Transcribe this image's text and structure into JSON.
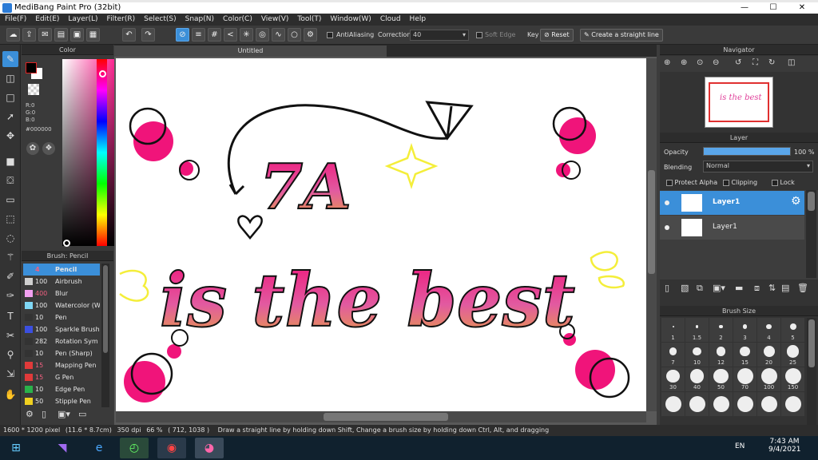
{
  "window": {
    "title": "MediBang Paint Pro (32bit)",
    "minimize": "—",
    "maximize": "☐",
    "close": "✕"
  },
  "menu": [
    "File(F)",
    "Edit(E)",
    "Layer(L)",
    "Filter(R)",
    "Select(S)",
    "Snap(N)",
    "Color(C)",
    "View(V)",
    "Tool(T)",
    "Window(W)",
    "Cloud",
    "Help"
  ],
  "toolbar": {
    "antialiasing_label": "AntiAliasing",
    "correction_label": "Correction",
    "correction_value": "40",
    "soft_edge_label": "Soft Edge",
    "key_label": "Key",
    "reset_label": "Reset",
    "straight_line_label": "Create a straight line"
  },
  "color_panel": {
    "title": "Color",
    "r": "R:0",
    "g": "G:0",
    "b": "B:0",
    "hex": "#000000",
    "foreground": "#000000",
    "background": "#ffffff"
  },
  "brush_panel": {
    "title": "Brush: Pencil",
    "items": [
      {
        "size": "4",
        "name": "Pencil",
        "color": "#3b8fd9"
      },
      {
        "size": "100",
        "name": "Airbrush",
        "color": "#cfcfcf"
      },
      {
        "size": "400",
        "name": "Blur",
        "color": "#f2a0f0"
      },
      {
        "size": "100",
        "name": "Watercolor (W",
        "color": "#7fd7f5"
      },
      {
        "size": "10",
        "name": "Pen",
        "color": "#333333"
      },
      {
        "size": "100",
        "name": "Sparkle Brush",
        "color": "#3b4fe0"
      },
      {
        "size": "282",
        "name": "Rotation Sym",
        "color": "#333333"
      },
      {
        "size": "10",
        "name": "Pen (Sharp)",
        "color": "#333333"
      },
      {
        "size": "15",
        "name": "Mapping Pen",
        "color": "#e03a3a"
      },
      {
        "size": "15",
        "name": "G Pen",
        "color": "#e03a3a"
      },
      {
        "size": "10",
        "name": "Edge Pen",
        "color": "#2ab24a"
      },
      {
        "size": "50",
        "name": "Stipple Pen",
        "color": "#f0d020"
      }
    ]
  },
  "document": {
    "tab": "Untitled"
  },
  "artwork": {
    "line1": "7A",
    "line2": "is the best",
    "accent": "#f0147a",
    "gold": "#e8a63a",
    "yellow": "#f4ee3a"
  },
  "navigator": {
    "title": "Navigator"
  },
  "layer_panel": {
    "title": "Layer",
    "opacity_label": "Opacity",
    "opacity_value": "100 %",
    "opacity": 1.0,
    "blending_label": "Blending",
    "blending_value": "Normal",
    "protect_alpha": "Protect Alpha",
    "clipping": "Clipping",
    "lock": "Lock",
    "layers": [
      {
        "name": "Layer1",
        "selected": true
      },
      {
        "name": "Layer1",
        "selected": false
      }
    ]
  },
  "brush_size_panel": {
    "title": "Brush Size",
    "sizes": [
      "1",
      "1.5",
      "2",
      "3",
      "4",
      "5",
      "7",
      "10",
      "12",
      "15",
      "20",
      "25",
      "30",
      "40",
      "50",
      "70",
      "100",
      "150",
      "",
      "",
      "",
      "",
      "",
      ""
    ]
  },
  "status": {
    "dimensions": "1600 * 1200 pixel",
    "physical": "(11.6 * 8.7cm)",
    "dpi": "350 dpi",
    "zoom": "66 %",
    "cursor": "( 712, 1038 )",
    "hint": "Draw a straight line by holding down Shift, Change a brush size by holding down Ctrl, Alt, and dragging"
  },
  "taskbar": {
    "lang": "EN",
    "time": "7:43 AM",
    "date": "9/4/2021"
  }
}
